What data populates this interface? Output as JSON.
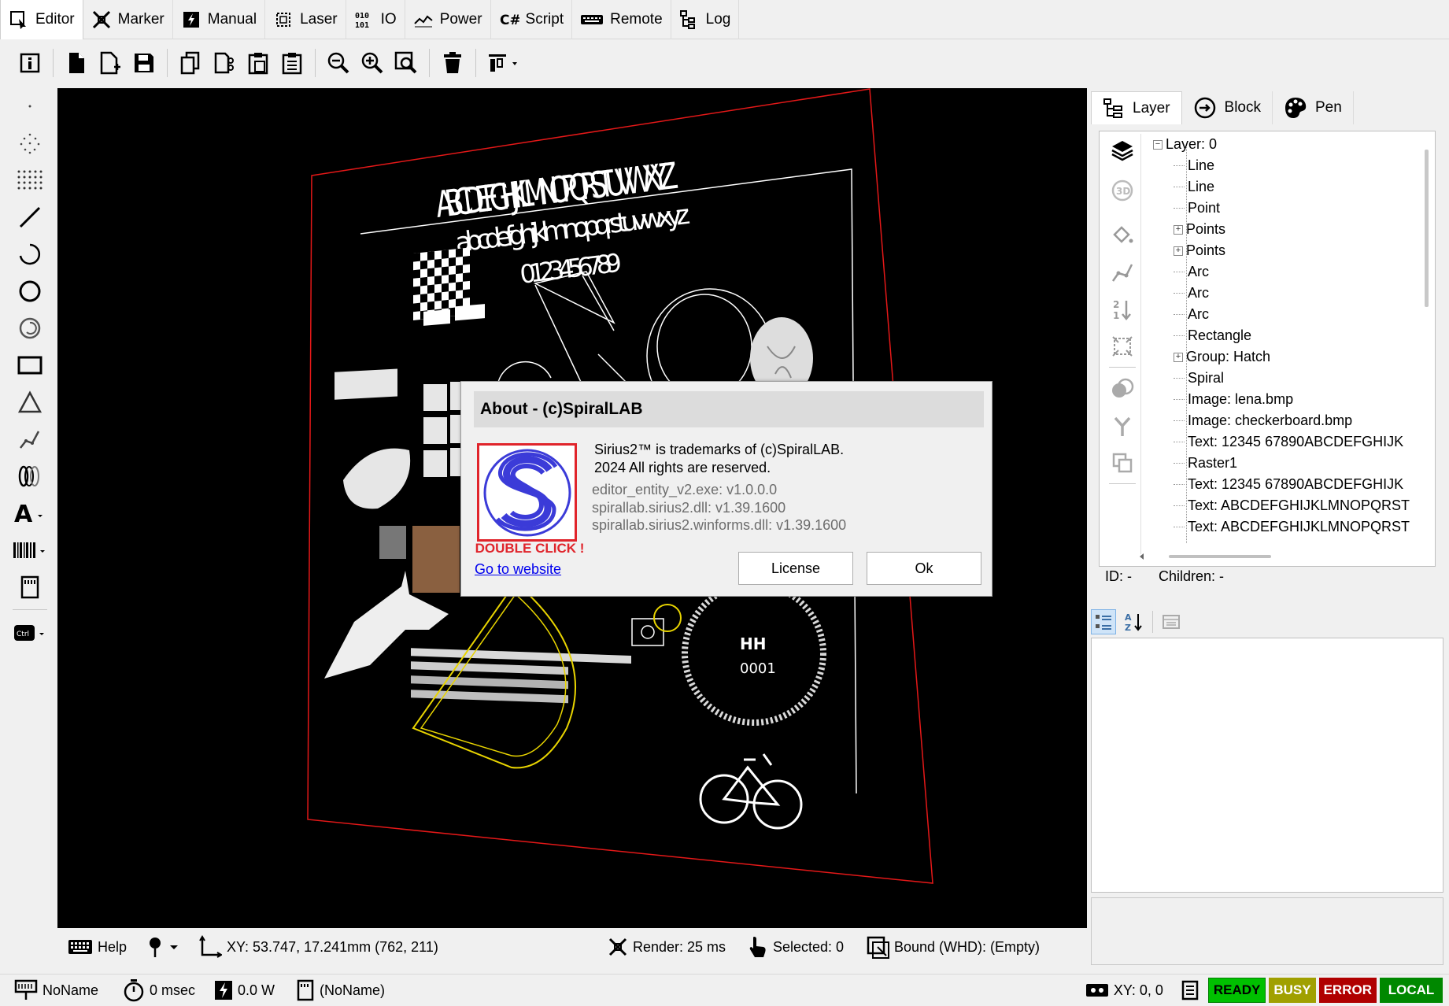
{
  "tabs": [
    {
      "label": "Editor",
      "icon": "editor-icon",
      "active": true
    },
    {
      "label": "Marker",
      "icon": "marker-icon"
    },
    {
      "label": "Manual",
      "icon": "manual-icon"
    },
    {
      "label": "Laser",
      "icon": "laser-icon"
    },
    {
      "label": "IO",
      "icon": "io-icon"
    },
    {
      "label": "Power",
      "icon": "power-icon"
    },
    {
      "label": "Script",
      "icon": "script-icon"
    },
    {
      "label": "Remote",
      "icon": "remote-icon"
    },
    {
      "label": "Log",
      "icon": "log-icon"
    }
  ],
  "canvas_text": {
    "upper": "ABCDEFGHIJKLMNOPQRSTUVWXYZ",
    "lower": "abcdefghijklmnopqrstuvwxyz",
    "digits": "0123456789",
    "hh": "HH",
    "serial": "0001",
    "circle_text": "ABCDEFGHIJKLMNOPQRSTUVWXYZ"
  },
  "panel": {
    "tabs": [
      {
        "label": "Layer",
        "icon": "layer-tree-icon",
        "active": true
      },
      {
        "label": "Block",
        "icon": "block-icon"
      },
      {
        "label": "Pen",
        "icon": "pen-palette-icon"
      }
    ],
    "tree": {
      "root": "Layer: 0",
      "children": [
        {
          "label": "Line",
          "expandable": false
        },
        {
          "label": "Line",
          "expandable": false
        },
        {
          "label": "Point",
          "expandable": false
        },
        {
          "label": "Points",
          "expandable": true
        },
        {
          "label": "Points",
          "expandable": true
        },
        {
          "label": "Arc",
          "expandable": false
        },
        {
          "label": "Arc",
          "expandable": false
        },
        {
          "label": "Arc",
          "expandable": false
        },
        {
          "label": "Rectangle",
          "expandable": false
        },
        {
          "label": "Group: Hatch",
          "expandable": true
        },
        {
          "label": "Spiral",
          "expandable": false
        },
        {
          "label": "Image: lena.bmp",
          "expandable": false
        },
        {
          "label": "Image: checkerboard.bmp",
          "expandable": false
        },
        {
          "label": "Text: 12345 67890ABCDEFGHIJK",
          "expandable": false
        },
        {
          "label": "Raster1",
          "expandable": false
        },
        {
          "label": "Text: 12345 67890ABCDEFGHIJK",
          "expandable": false
        },
        {
          "label": "Text: ABCDEFGHIJKLMNOPQRST",
          "expandable": false
        },
        {
          "label": "Text: ABCDEFGHIJKLMNOPQRST",
          "expandable": false
        }
      ]
    },
    "id_label": "ID: -",
    "children_label": "Children: -"
  },
  "status_bar": {
    "help": "Help",
    "xy": "XY: 53.747, 17.241mm (762, 211)",
    "render": "Render: 25 ms",
    "selected": "Selected: 0",
    "bound": "Bound (WHD): (Empty)"
  },
  "bottom_bar": {
    "name": "NoName",
    "time": "0 msec",
    "power": "0.0 W",
    "doc": "(NoName)",
    "xy": "XY: 0, 0",
    "badges": [
      {
        "label": "READY",
        "color": "#00c000"
      },
      {
        "label": "BUSY",
        "color": "#a0a000"
      },
      {
        "label": "ERROR",
        "color": "#b00000"
      },
      {
        "label": "LOCAL",
        "color": "#008800"
      }
    ]
  },
  "dialog": {
    "title": "About - (c)SpiralLAB",
    "line1": "Sirius2™ is trademarks of (c)SpiralLAB.",
    "line2": "2024 All rights are reserved.",
    "ver1": "editor_entity_v2.exe: v1.0.0.0",
    "ver2": "spirallab.sirius2.dll: v1.39.1600",
    "ver3": "spirallab.sirius2.winforms.dll: v1.39.1600",
    "double_click": "DOUBLE CLICK !",
    "website_link": "Go to website",
    "license_button": "License",
    "ok_button": "Ok",
    "logo_letter": "S"
  },
  "colors": {
    "accent_red": "#e0242b",
    "logo_blue": "#3b3bd8",
    "canvas_bg": "#000000",
    "frame_red": "#ff0000"
  }
}
